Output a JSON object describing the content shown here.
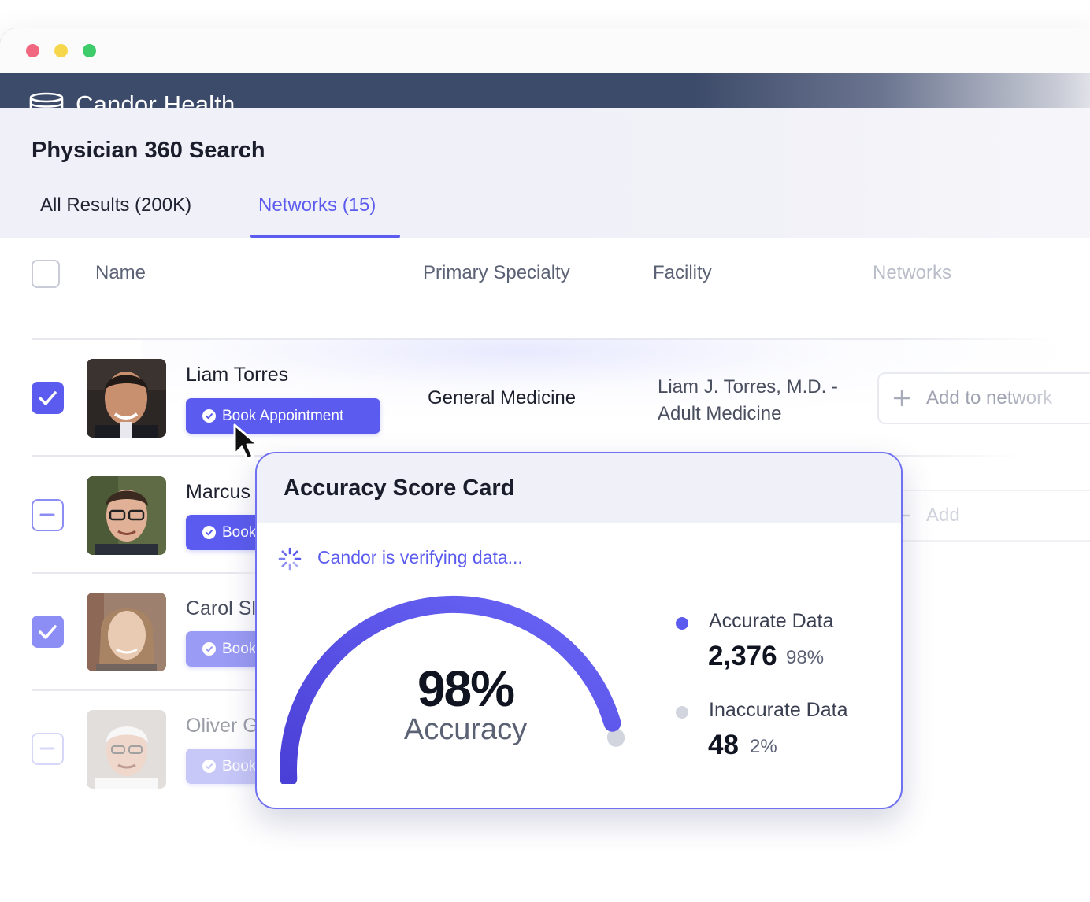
{
  "app": {
    "brand": "Candor Health"
  },
  "page": {
    "title": "Physician 360 Search",
    "tabs": [
      {
        "label": "All Results (200K)",
        "active": false
      },
      {
        "label": "Networks (15)",
        "active": true
      }
    ]
  },
  "table": {
    "columns": [
      "Name",
      "Primary Specialty",
      "Facility",
      "Networks"
    ],
    "rows": [
      {
        "name": "Liam Torres",
        "button": "Book Appointment",
        "specialty": "General Medicine",
        "facility_line1": "Liam J. Torres, M.D. -",
        "facility_line2": "Adult Medicine",
        "network_action": "Add to network",
        "selected": "checked"
      },
      {
        "name": "Marcus",
        "button": "Book",
        "network_action": "Add",
        "selected": "indeterminate"
      },
      {
        "name": "Carol Sl",
        "button": "Book",
        "selected": "checked"
      },
      {
        "name": "Oliver G",
        "button": "Book",
        "selected": "indeterminate"
      }
    ]
  },
  "scorecard": {
    "title": "Accuracy Score Card",
    "status": "Candor is verifying data...",
    "gauge": {
      "value": 98,
      "value_label": "98%",
      "caption": "Accuracy"
    },
    "legend": [
      {
        "label": "Accurate Data",
        "count": "2,376",
        "percent": "98%",
        "color": "#5b5cef"
      },
      {
        "label": "Inaccurate Data",
        "count": "48",
        "percent": "2%",
        "color": "#d3d5de"
      }
    ]
  },
  "colors": {
    "accent": "#5b5cef",
    "appbar": "#3d4b6a"
  }
}
